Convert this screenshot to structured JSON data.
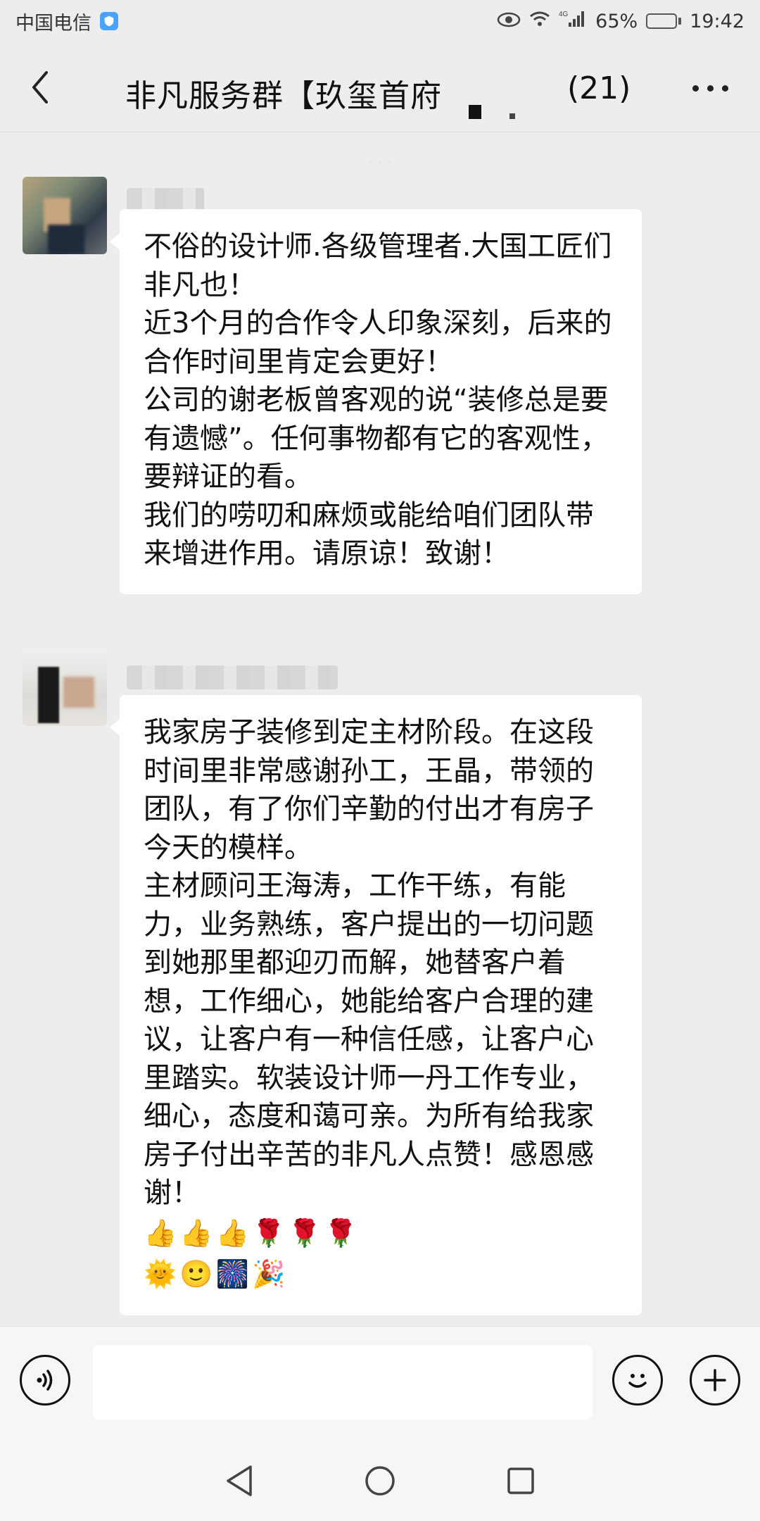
{
  "status_bar": {
    "carrier": "中国电信",
    "battery_percent": "65%",
    "battery_level": 0.65,
    "time": "19:42",
    "network": "4G",
    "icons": [
      "hd-badge-icon",
      "eye-icon",
      "wifi-icon",
      "signal-icon",
      "battery-icon"
    ]
  },
  "header": {
    "title": "非凡服务群【玖玺首府",
    "member_count": "(21)",
    "back_icon": "chevron-left-icon",
    "more_icon": "more-dots-icon"
  },
  "messages": [
    {
      "avatar": "blurred-avatar",
      "lines": [
        "不俗的设计师.各级管理者.大国工匠们非凡也！",
        "近3个月的合作令人印象深刻，后来的合作时间里肯定会更好！",
        "公司的谢老板曾客观的说“装修总是要有遗憾”。任何事物都有它的客观性，要辩证的看。",
        "我们的唠叨和麻烦或能给咱们团队带来增进作用。请原谅！致谢！"
      ]
    },
    {
      "avatar": "blurred-avatar",
      "lines": [
        "我家房子装修到定主材阶段。在这段时间里非常感谢孙工，王晶，带领的团队，有了你们辛勤的付出才有房子今天的模样。",
        "主材顾问王海涛，工作干练，有能力，业务熟练，客户提出的一切问题到她那里都迎刃而解，她替客户着想，工作细心，她能给客户合理的建议，让客户有一种信任感，让客户心里踏实。软装设计师一丹工作专业，细心，态度和蔼可亲。为所有给我家房子付出辛苦的非凡人点赞！感恩感谢！"
      ],
      "emoji_row_1": [
        "👍",
        "👍",
        "👍",
        "🌹",
        "🌹",
        "🌹"
      ],
      "emoji_row_2": [
        "🌞",
        "🙂",
        "🎆",
        "🎉"
      ]
    }
  ],
  "input_bar": {
    "placeholder": "",
    "voice_icon": "voice-icon",
    "emoji_icon": "emoji-icon",
    "plus_icon": "plus-icon"
  },
  "nav_bar": {
    "icons": [
      "nav-back-icon",
      "nav-home-icon",
      "nav-recent-icon"
    ]
  }
}
